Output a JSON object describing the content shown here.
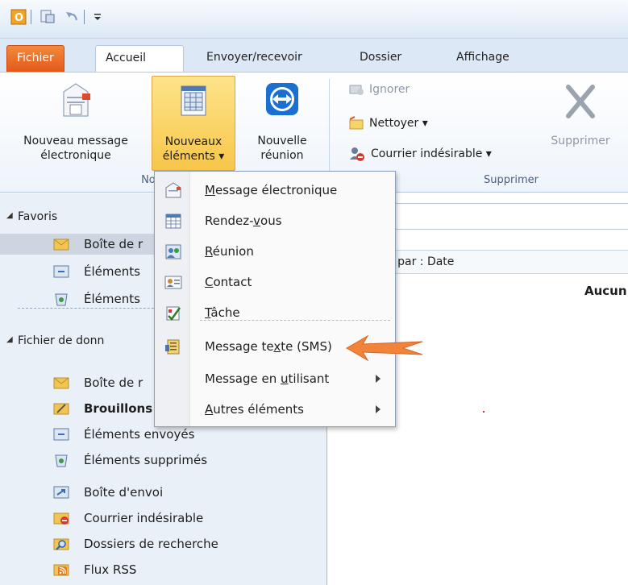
{
  "tabs": {
    "file": "Fichier",
    "home": "Accueil",
    "send_receive": "Envoyer/recevoir",
    "folder": "Dossier",
    "view": "Affichage"
  },
  "ribbon": {
    "new_email": [
      "Nouveau message",
      "électronique"
    ],
    "new_items": [
      "Nouveaux",
      "éléments ▾"
    ],
    "new_meeting": [
      "Nouvelle",
      "réunion"
    ],
    "ignore": "Ignorer",
    "clean_up": "Nettoyer ▾",
    "junk": "Courrier indésirable ▾",
    "delete": "Supprimer",
    "group_new": "Nouveau",
    "group_delete": "Supprimer"
  },
  "menu": {
    "items": [
      {
        "pre": "",
        "u": "M",
        "post": "essage électronique"
      },
      {
        "pre": "Rendez-",
        "u": "v",
        "post": "ous"
      },
      {
        "pre": "",
        "u": "R",
        "post": "éunion"
      },
      {
        "pre": "",
        "u": "C",
        "post": "ontact"
      },
      {
        "pre": "",
        "u": "T",
        "post": "âche"
      },
      {
        "pre": "Message te",
        "u": "x",
        "post": "te (SMS)"
      },
      {
        "pre": "Message en ",
        "u": "u",
        "post": "tilisant"
      },
      {
        "pre": "",
        "u": "A",
        "post": "utres éléments"
      }
    ]
  },
  "nav": {
    "favorites": "Favoris",
    "fav_items": [
      "Boîte de r",
      "Éléments",
      "Éléments"
    ],
    "data_file": "Fichier de donn",
    "items": [
      "Boîte de r",
      "Brouillons",
      "Éléments envoyés",
      "Éléments supprimés",
      "Boîte d'envoi",
      "Courrier indésirable",
      "Dossiers de recherche",
      "Flux RSS"
    ]
  },
  "list": {
    "sort": "ser par : Date",
    "empty": "Aucun"
  },
  "colors": {
    "accent_orange": "#f0843c",
    "ribbon_bg": "#dce8f5"
  }
}
